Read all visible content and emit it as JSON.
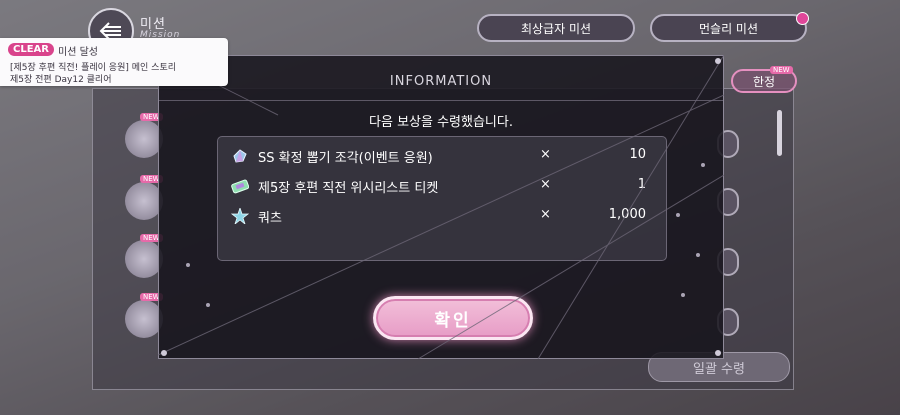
{
  "header": {
    "title": "미션",
    "subtitle": "Mission",
    "tabs": [
      {
        "label": "최상급자 미션"
      },
      {
        "label": "먼슬리 미션"
      }
    ]
  },
  "toast": {
    "badge": "CLEAR",
    "title": "미션 달성",
    "line1": "[제5장 후편 직전! 플레이 응원] 메인 스토리",
    "line2": "제5장 전편 Day12 클리어"
  },
  "background": {
    "tab_label": "한정",
    "new_label": "NEW",
    "bulk_button": "일괄 수령"
  },
  "modal": {
    "title": "INFORMATION",
    "message": "다음 보상을 수령했습니다.",
    "rewards": [
      {
        "name": "SS 확정 뽑기 조각(이벤트 응원)",
        "times": "×",
        "qty": "10",
        "icon": "gem-fragment-icon"
      },
      {
        "name": "제5장 후편 직전 위시리스트 티켓",
        "times": "×",
        "qty": "1",
        "icon": "ticket-icon"
      },
      {
        "name": "쿼츠",
        "times": "×",
        "qty": "1,000",
        "icon": "quartz-icon"
      }
    ],
    "confirm_label": "확인"
  },
  "colors": {
    "accent_pink": "#e79cc6",
    "badge_pink": "#d9448c",
    "modal_bg": "#16141c"
  }
}
